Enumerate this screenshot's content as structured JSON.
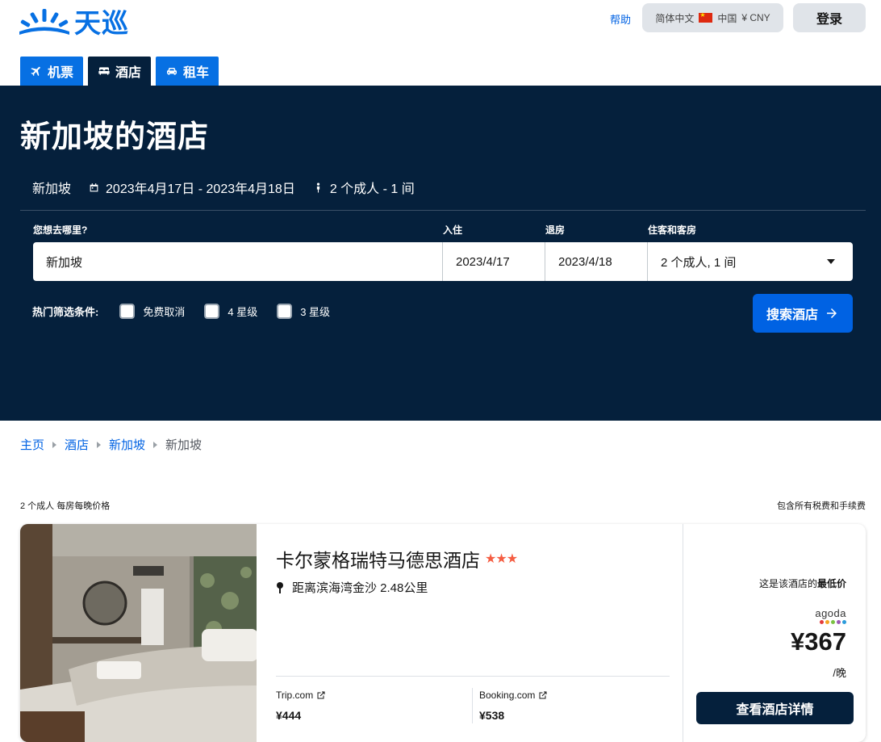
{
  "brand": {
    "name": "天巡"
  },
  "header": {
    "help": "帮助",
    "language": "简体中文",
    "region": "中国",
    "currency": "¥ CNY",
    "login": "登录"
  },
  "tabs": [
    {
      "label": "机票",
      "icon": "plane-icon"
    },
    {
      "label": "酒店",
      "icon": "bed-icon"
    },
    {
      "label": "租车",
      "icon": "car-icon"
    }
  ],
  "hero": {
    "title": "新加坡的酒店",
    "summary": {
      "destination": "新加坡",
      "dates": "2023年4月17日 - 2023年4月18日",
      "guests": "2 个成人 - 1 间"
    }
  },
  "search": {
    "labels": {
      "destination": "您想去哪里?",
      "checkin": "入住",
      "checkout": "退房",
      "guests": "住客和客房"
    },
    "destination": "新加坡",
    "checkin": "2023/4/17",
    "checkout": "2023/4/18",
    "guests": "2 个成人, 1 间",
    "button": "搜索酒店"
  },
  "filters": {
    "label": "热门筛选条件:",
    "options": [
      "免费取消",
      "4 星级",
      "3 星级"
    ]
  },
  "breadcrumb": [
    "主页",
    "酒店",
    "新加坡",
    "新加坡"
  ],
  "results": {
    "price_note": "2 个成人 每房每晚价格",
    "tax_note": "包含所有税费和手续费"
  },
  "hotel": {
    "name": "卡尔蒙格瑞特马德思酒店",
    "stars": "★★★",
    "distance": "距离滨海湾金沙 2.48公里",
    "providers": [
      {
        "name": "Trip.com",
        "price": "¥444"
      },
      {
        "name": "Booking.com",
        "price": "¥538"
      }
    ],
    "deal": {
      "cheapest_prefix": "这是该酒店的",
      "cheapest_bold": "最低价",
      "provider": "agoda",
      "price": "¥367",
      "per_night": "/晚",
      "button": "查看酒店详情"
    }
  }
}
